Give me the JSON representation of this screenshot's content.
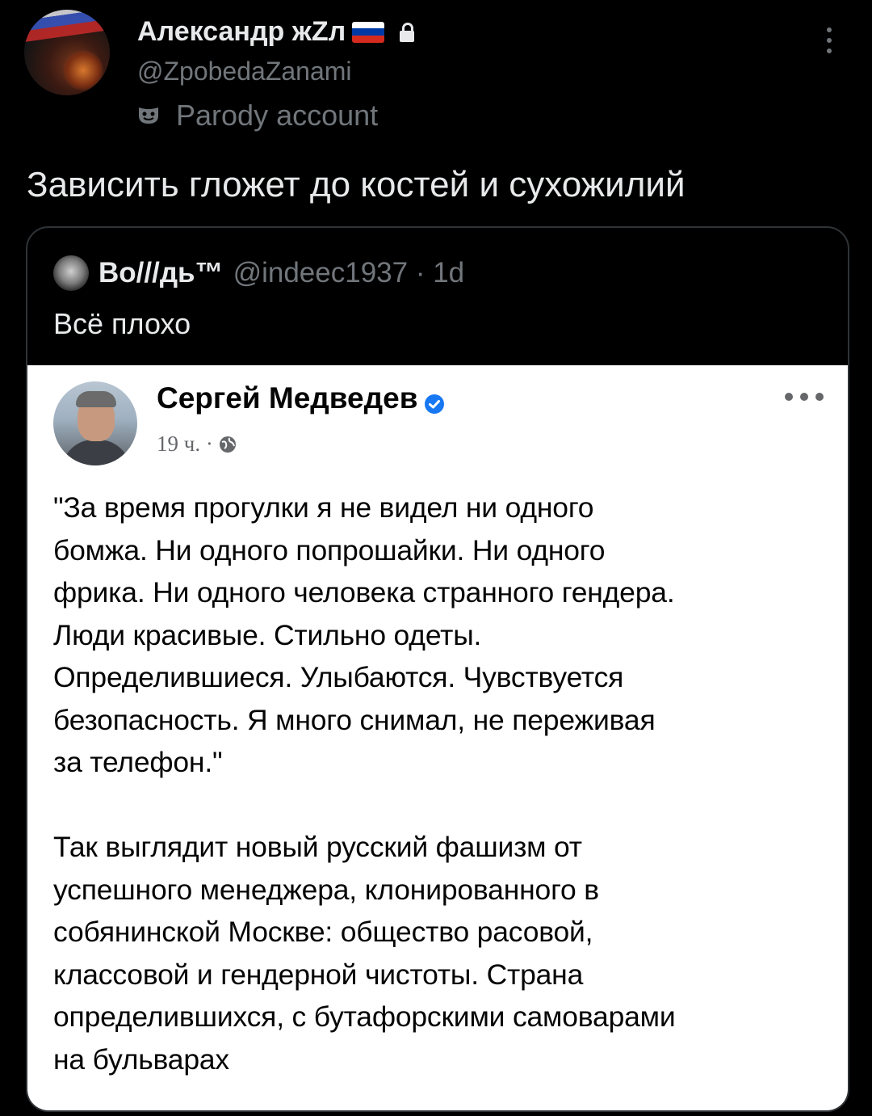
{
  "post": {
    "author_name": "Александр жZл",
    "handle": "@ZpobedaZanami",
    "parody_label": "Parody account",
    "text": "Зависить гложет до костей и сухожилий"
  },
  "quote": {
    "author_name": "Во///дь™",
    "meta": "@indeec1937 · 1d",
    "text": "Всё плохо"
  },
  "screenshot": {
    "author_name": "Сергей Медведев",
    "time": "19 ч. ·",
    "paragraph_1": "\"За время прогулки я не видел ни одного\nбомжа. Ни одного попрошайки. Ни одного\nфрика. Ни одного человека странного гендера.\nЛюди красивые. Стильно одеты.\nОпределившиеся. Улыбаются. Чувствуется\nбезопасность. Я много снимал, не переживая\nза телефон.\"",
    "paragraph_2": "Так выглядит новый русский фашизм от\nуспешного менеджера, клонированного в\nсобянинской Москве: общество расовой,\nклассовой и гендерной чистоты. Страна\nопределившихся, с бутафорскими самоварами\nна бульварах"
  },
  "icons": {
    "flag": "russia-flag-icon",
    "lock": "lock-icon",
    "mask": "parody-mask-icon",
    "more": "more-vertical-icon",
    "verified": "verified-badge-icon",
    "globe": "globe-icon",
    "fb_more": "more-horizontal-icon"
  },
  "colors": {
    "background": "#000000",
    "text_primary": "#e7e9ea",
    "text_secondary": "#71767b",
    "verified_blue": "#1877f2",
    "flag_white": "#ffffff",
    "flag_blue": "#0039a6",
    "flag_red": "#d52b1e"
  }
}
